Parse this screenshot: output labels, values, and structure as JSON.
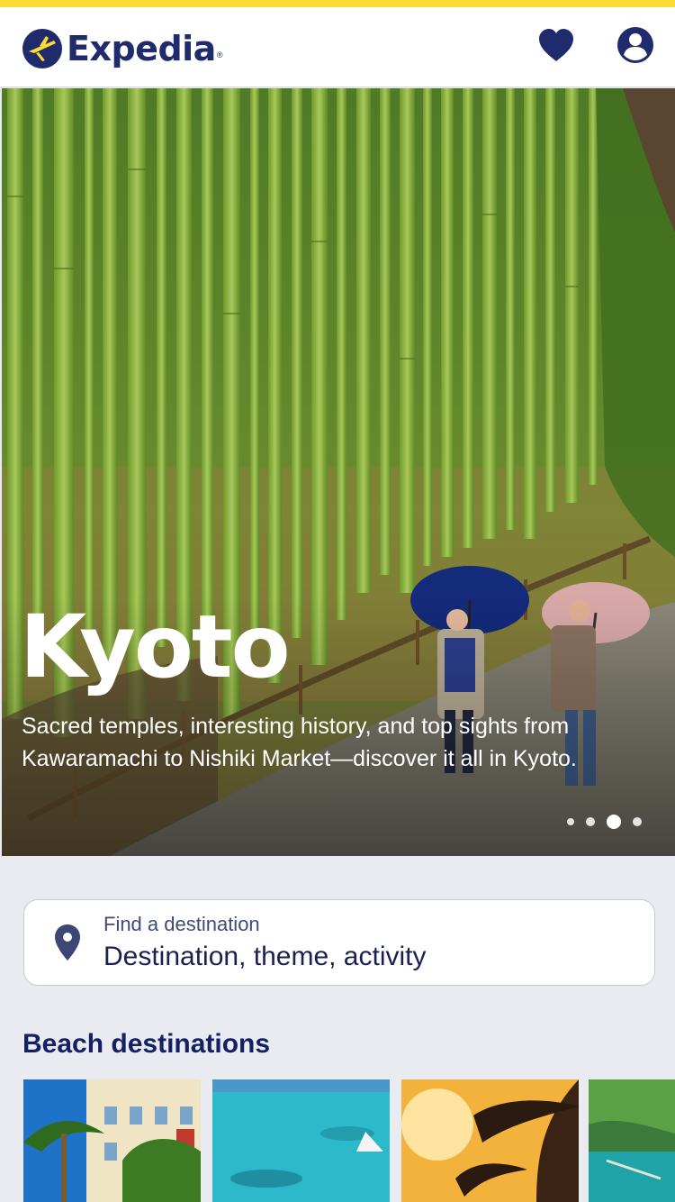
{
  "header": {
    "brand": "Expedia",
    "brand_mark": "®",
    "icons": [
      "heart-icon",
      "account-icon"
    ]
  },
  "hero": {
    "title": "Kyoto",
    "description": "Sacred temples, interesting history, and top sights from Kawaramachi to Nishiki Market—discover it all in Kyoto.",
    "carousel": {
      "count": 4,
      "active_index": 2
    }
  },
  "search": {
    "label": "Find a destination",
    "value": "Destination, theme, activity"
  },
  "sections": {
    "beach_title": "Beach destinations"
  },
  "colors": {
    "accent_yellow": "#fddb32",
    "brand_navy": "#1f2b6c",
    "background": "#e9ebf0"
  }
}
